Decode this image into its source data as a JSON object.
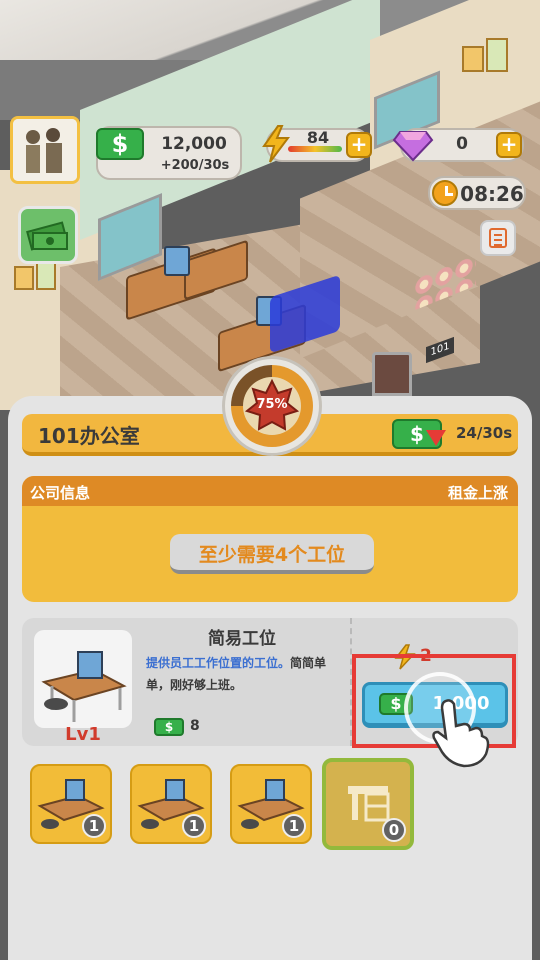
{
  "hud": {
    "cash_value": "12,000",
    "cash_rate": "+200/30s",
    "energy_value": "84",
    "gem_value": "0",
    "timer": "08:26",
    "money_icon": "$"
  },
  "room": {
    "sign": "101",
    "progress_label": "75%",
    "progress_fraction": 0.75,
    "title": "101办公室",
    "rent_rate": "24/30s"
  },
  "company_info": {
    "header_left": "公司信息",
    "header_right": "租金上涨",
    "requirement": "至少需要4个工位"
  },
  "item": {
    "name": "简易工位",
    "desc_highlight": "提供员工工作位置的工位。",
    "desc_rest": "简简单单，刚好够上班。",
    "level": "Lv1",
    "income": "8",
    "energy_cost": "2",
    "price": "1,000"
  },
  "slots": [
    {
      "count": "1"
    },
    {
      "count": "1"
    },
    {
      "count": "1"
    },
    {
      "count": "0"
    }
  ],
  "colors": {
    "accent_orange": "#e38a1e",
    "highlight_red": "#e63b36",
    "buy_blue": "#5bc3e8",
    "money_green": "#36b04a",
    "slot_yellow": "#f2bc38"
  }
}
